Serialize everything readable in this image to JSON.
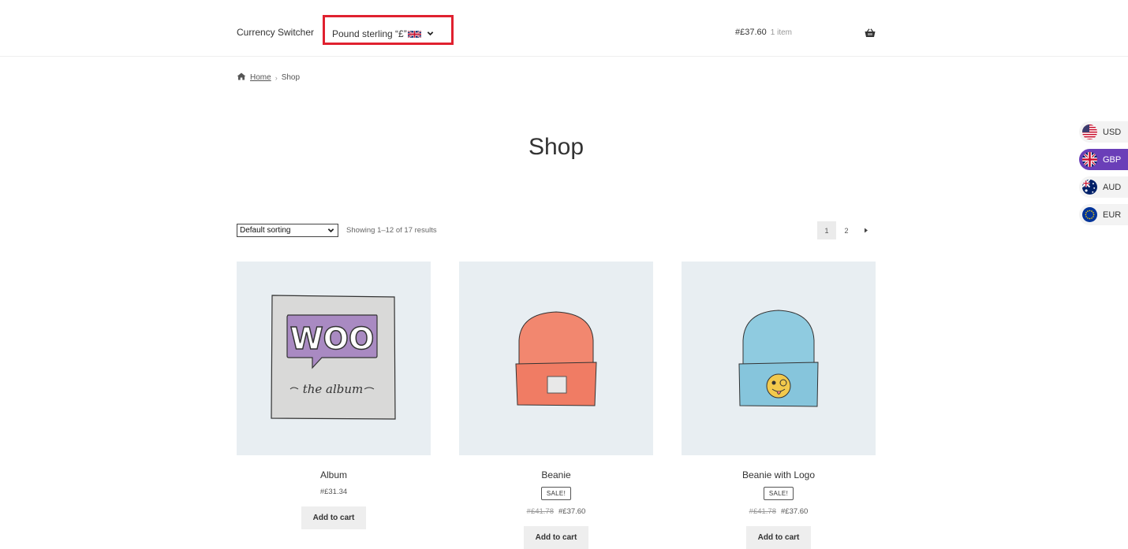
{
  "header": {
    "site_title": "Currency Switcher",
    "currency_dropdown": {
      "label": "Pound sterling “£”",
      "flag": "uk-flag-icon"
    },
    "cart": {
      "total": "#£37.60",
      "count": "1 item"
    }
  },
  "breadcrumb": {
    "home": "Home",
    "current": "Shop"
  },
  "page_title": "Shop",
  "toolbar": {
    "sorting": "Default sorting",
    "result_count": "Showing 1–12 of 17 results",
    "pages": [
      "1",
      "2"
    ]
  },
  "products": [
    {
      "title": "Album",
      "price": "#£31.34",
      "button": "Add to cart"
    },
    {
      "title": "Beanie",
      "badge": "SALE!",
      "old_price": "#£41.78",
      "price": "#£37.60",
      "button": "Add to cart"
    },
    {
      "title": "Beanie with Logo",
      "badge": "SALE!",
      "old_price": "#£41.78",
      "price": "#£37.60",
      "button": "Add to cart"
    }
  ],
  "currency_switcher": [
    {
      "code": "USD",
      "active": false
    },
    {
      "code": "GBP",
      "active": true
    },
    {
      "code": "AUD",
      "active": false
    },
    {
      "code": "EUR",
      "active": false
    }
  ],
  "colors": {
    "highlight_box": "#e0212f",
    "active_currency": "#6a3fb8",
    "thumb_bg": "#e8eef2"
  }
}
